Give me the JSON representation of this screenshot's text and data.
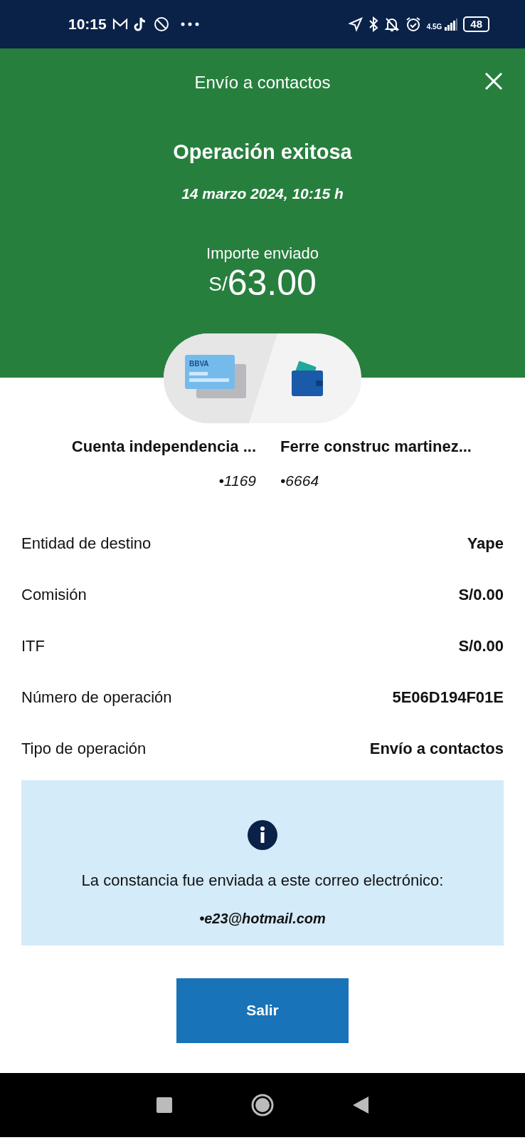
{
  "status_bar": {
    "time": "10:15",
    "network": "4.5G",
    "battery": "48"
  },
  "header": {
    "title": "Envío a contactos",
    "headline": "Operación exitosa",
    "datetime": "14 marzo 2024, 10:15 h",
    "amount_label": "Importe enviado",
    "currency": "S/",
    "amount": "63.00"
  },
  "transfer": {
    "card_label": "BBVA",
    "from": {
      "name": "Cuenta independencia ...",
      "number": "•1169"
    },
    "to": {
      "name": "Ferre construc martinez...",
      "number": "•6664"
    }
  },
  "details": [
    {
      "label": "Entidad de destino",
      "value": "Yape"
    },
    {
      "label": "Comisión",
      "value": "S/0.00"
    },
    {
      "label": "ITF",
      "value": "S/0.00"
    },
    {
      "label": "Número de operación",
      "value": "5E06D194F01E"
    },
    {
      "label": "Tipo de operación",
      "value": "Envío a contactos"
    }
  ],
  "notice": {
    "text": "La constancia fue enviada a este correo electrónico:",
    "email": "•e23@hotmail.com"
  },
  "button": "Salir"
}
